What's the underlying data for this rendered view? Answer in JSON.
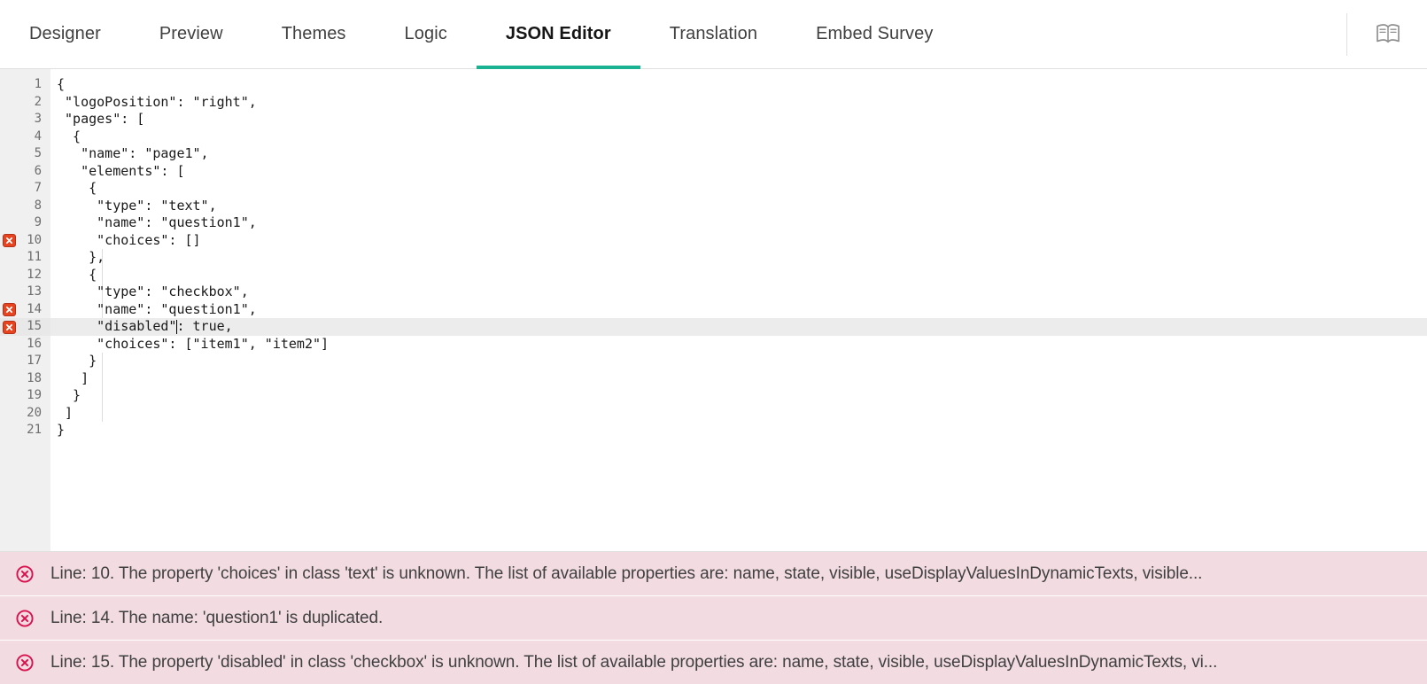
{
  "tabs": [
    {
      "label": "Designer",
      "active": false
    },
    {
      "label": "Preview",
      "active": false
    },
    {
      "label": "Themes",
      "active": false
    },
    {
      "label": "Logic",
      "active": false
    },
    {
      "label": "JSON Editor",
      "active": true
    },
    {
      "label": "Translation",
      "active": false
    },
    {
      "label": "Embed Survey",
      "active": false
    }
  ],
  "toolbar": {
    "doc_icon": "open-book-icon"
  },
  "colors": {
    "accent": "#19b394",
    "error_marker": "#e8431f",
    "error_row_bg": "#f2dce2",
    "error_icon": "#d9114e",
    "gutter_bg": "#f0f0f0",
    "active_line_bg": "#ececec"
  },
  "editor": {
    "active_line": 15,
    "cursor_line": 15,
    "cursor_column": 19,
    "lines": [
      {
        "n": 1,
        "text": "{",
        "error": false
      },
      {
        "n": 2,
        "text": " \"logoPosition\": \"right\",",
        "error": false
      },
      {
        "n": 3,
        "text": " \"pages\": [",
        "error": false
      },
      {
        "n": 4,
        "text": "  {",
        "error": false
      },
      {
        "n": 5,
        "text": "   \"name\": \"page1\",",
        "error": false
      },
      {
        "n": 6,
        "text": "   \"elements\": [",
        "error": false
      },
      {
        "n": 7,
        "text": "    {",
        "error": false
      },
      {
        "n": 8,
        "text": "     \"type\": \"text\",",
        "error": false
      },
      {
        "n": 9,
        "text": "     \"name\": \"question1\",",
        "error": false
      },
      {
        "n": 10,
        "text": "     \"choices\": []",
        "error": true
      },
      {
        "n": 11,
        "text": "    },",
        "error": false
      },
      {
        "n": 12,
        "text": "    {",
        "error": false
      },
      {
        "n": 13,
        "text": "     \"type\": \"checkbox\",",
        "error": false
      },
      {
        "n": 14,
        "text": "     \"name\": \"question1\",",
        "error": true
      },
      {
        "n": 15,
        "text": "     \"disabled\"",
        "text_after": ": true,",
        "error": true
      },
      {
        "n": 16,
        "text": "     \"choices\": [\"item1\", \"item2\"]",
        "error": false
      },
      {
        "n": 17,
        "text": "    }",
        "error": false
      },
      {
        "n": 18,
        "text": "   ]",
        "error": false
      },
      {
        "n": 19,
        "text": "  }",
        "error": false
      },
      {
        "n": 20,
        "text": " ]",
        "error": false
      },
      {
        "n": 21,
        "text": "}",
        "error": false
      }
    ]
  },
  "errors": [
    {
      "text": "Line: 10. The property 'choices' in class 'text' is unknown. The list of available properties are: name, state, visible, useDisplayValuesInDynamicTexts, visible..."
    },
    {
      "text": "Line: 14. The name: 'question1' is duplicated."
    },
    {
      "text": "Line: 15. The property 'disabled' in class 'checkbox' is unknown. The list of available properties are: name, state, visible, useDisplayValuesInDynamicTexts, vi..."
    }
  ]
}
